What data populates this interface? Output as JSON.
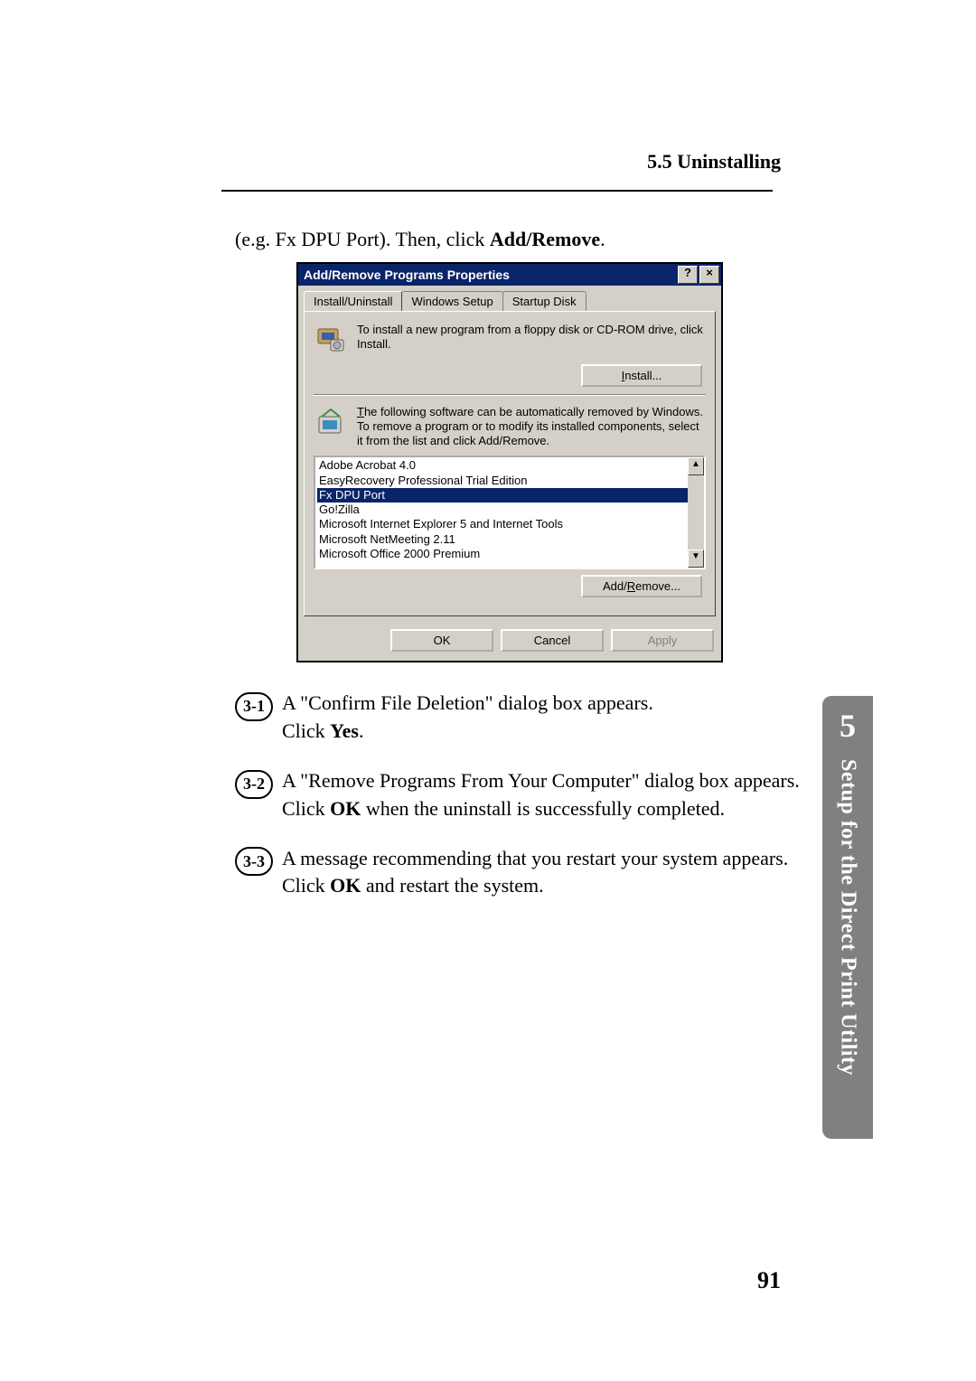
{
  "header": {
    "section_title": "5.5 Uninstalling"
  },
  "intro": {
    "prefix": "(e.g. Fx DPU Port). Then, click ",
    "bold": "Add/Remove",
    "suffix": "."
  },
  "dialog": {
    "title": "Add/Remove Programs Properties",
    "help_btn": "?",
    "close_btn": "×",
    "tabs": {
      "install": "Install/Uninstall",
      "winsetup": "Windows Setup",
      "startup": "Startup Disk"
    },
    "install_text": "To install a new program from a floppy disk or CD-ROM drive, click Install.",
    "install_btn": "Install...",
    "remove_text": "The following software can be automatically removed by Windows. To remove a program or to modify its installed components, select it from the list and click Add/Remove.",
    "list": {
      "items": [
        "Adobe Acrobat 4.0",
        "EasyRecovery Professional Trial Edition",
        "Fx DPU Port",
        "Go!Zilla",
        "Microsoft Internet Explorer 5 and Internet Tools",
        "Microsoft NetMeeting 2.11",
        "Microsoft Office 2000 Premium"
      ],
      "selected_index": 2
    },
    "addremove_btn": "Add/Remove...",
    "ok_btn": "OK",
    "cancel_btn": "Cancel",
    "apply_btn": "Apply"
  },
  "steps": [
    {
      "label": "3-1",
      "text_before": "A \"Confirm File Deletion\" dialog box appears.",
      "text_after_prefix": "Click ",
      "text_after_bold": "Yes",
      "text_after_suffix": "."
    },
    {
      "label": "3-2",
      "text_before": "A \"Remove Programs From Your Computer\" dialog box appears.",
      "text_after_prefix": "Click ",
      "text_after_bold": "OK",
      "text_after_suffix": " when the uninstall is successfully completed."
    },
    {
      "label": "3-3",
      "text_before": "A message recommending that you restart your system appears.",
      "text_after_prefix": "Click ",
      "text_after_bold": "OK",
      "text_after_suffix": " and restart the system."
    }
  ],
  "sidetab": {
    "chapter": "5",
    "title": "Setup for the Direct Print Utility"
  },
  "page_number": "91"
}
